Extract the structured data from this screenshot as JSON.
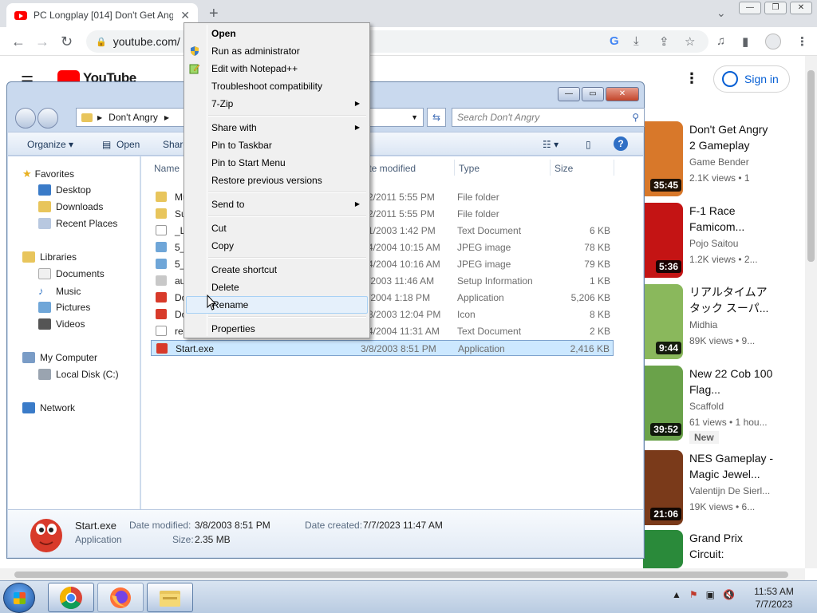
{
  "browser": {
    "tab_title": "PC Longplay [014] Don't Get Angry",
    "tab_close": "✕",
    "new_tab": "+",
    "url": "youtube.com/"
  },
  "youtube": {
    "logo": "YouTube",
    "sign_in": "Sign in",
    "videos": [
      {
        "title": "Don't Get Angry 2 Gameplay",
        "channel": "Game Bender",
        "meta": "2.1K views • 1",
        "duration": "35:45",
        "thumb_color": "#d8782a"
      },
      {
        "title": "F-1 Race Famicom...",
        "channel": "Pojo Saitou",
        "meta": "1.2K views • 2...",
        "duration": "5:36",
        "thumb_color": "#c41414"
      },
      {
        "title": "リアルタイムアタック スーパ...",
        "channel": "Midhia",
        "meta": "89K views • 9...",
        "duration": "9:44",
        "thumb_color": "#8ab85c"
      },
      {
        "title": "New 22 Cob 100 Flag...",
        "channel": "Scaffold",
        "meta": "61 views • 1 hou...",
        "badge": "New",
        "duration": "39:52",
        "thumb_color": "#6aa24a"
      },
      {
        "title": "NES Gameplay - Magic Jewel...",
        "channel": "Valentijn De Sierl...",
        "meta": "19K views • 6...",
        "duration": "21:06",
        "thumb_color": "#7a3a1a"
      },
      {
        "title": "Grand Prix Circuit:",
        "channel": "",
        "meta": "",
        "duration": "",
        "thumb_color": "#2a8a3a"
      }
    ]
  },
  "explorer": {
    "address": "Don't Angry",
    "search_placeholder": "Search Don't Angry",
    "commands": {
      "organize": "Organize ▾",
      "open": "Open",
      "share": "Share"
    },
    "columns": {
      "name": "Name",
      "date": "Date modified",
      "type": "Type",
      "size": "Size"
    },
    "nav": {
      "favorites": "Favorites",
      "desktop": "Desktop",
      "downloads": "Downloads",
      "recent": "Recent Places",
      "libraries": "Libraries",
      "documents": "Documents",
      "music": "Music",
      "pictures": "Pictures",
      "videos": "Videos",
      "computer": "My Computer",
      "local_disk": "Local Disk (C:)",
      "network": "Network"
    },
    "files": [
      {
        "name": "Mu",
        "date": "/22/2011 5:55 PM",
        "type": "File folder",
        "size": "",
        "icon": "#e8c55c"
      },
      {
        "name": "Sup",
        "date": "/22/2011 5:55 PM",
        "type": "File folder",
        "size": "",
        "icon": "#e8c55c"
      },
      {
        "name": "_Le",
        "date": "/21/2003 1:42 PM",
        "type": "Text Document",
        "size": "6 KB",
        "icon": "#ffffff"
      },
      {
        "name": "5_1",
        "date": "/14/2004 10:15 AM",
        "type": "JPEG image",
        "size": "78 KB",
        "icon": "#6fa6d8"
      },
      {
        "name": "5_2",
        "date": "/14/2004 10:16 AM",
        "type": "JPEG image",
        "size": "79 KB",
        "icon": "#6fa6d8"
      },
      {
        "name": "aut",
        "date": "/6/2003 11:46 AM",
        "type": "Setup Information",
        "size": "1 KB",
        "icon": "#c8c8c8"
      },
      {
        "name": "Do",
        "date": "/5/2004 1:18 PM",
        "type": "Application",
        "size": "5,206 KB",
        "icon": "#d83a2a"
      },
      {
        "name": "Do",
        "date": "/28/2003 12:04 PM",
        "type": "Icon",
        "size": "8 KB",
        "icon": "#d83a2a"
      },
      {
        "name": "rea",
        "date": "/14/2004 11:31 AM",
        "type": "Text Document",
        "size": "2 KB",
        "icon": "#ffffff"
      },
      {
        "name": "Start.exe",
        "date": "3/8/2003 8:51 PM",
        "type": "Application",
        "size": "2,416 KB",
        "icon": "#d83a2a",
        "selected": true
      }
    ],
    "details": {
      "name": "Start.exe",
      "kind": "Application",
      "modified_label": "Date modified:",
      "modified": "3/8/2003 8:51 PM",
      "created_label": "Date created:",
      "created": "7/7/2023 11:47 AM",
      "size_label": "Size:",
      "size": "2.35 MB"
    }
  },
  "context_menu": {
    "items": [
      {
        "label": "Open",
        "bold": true
      },
      {
        "label": "Run as administrator",
        "icon": "shield"
      },
      {
        "label": "Edit with Notepad++",
        "icon": "notepad"
      },
      {
        "label": "Troubleshoot compatibility"
      },
      {
        "label": "7-Zip",
        "submenu": true
      },
      {
        "separator": true
      },
      {
        "label": "Share with",
        "submenu": true
      },
      {
        "label": "Pin to Taskbar"
      },
      {
        "label": "Pin to Start Menu"
      },
      {
        "label": "Restore previous versions"
      },
      {
        "separator": true
      },
      {
        "label": "Send to",
        "submenu": true
      },
      {
        "separator": true
      },
      {
        "label": "Cut"
      },
      {
        "label": "Copy"
      },
      {
        "separator": true
      },
      {
        "label": "Create shortcut"
      },
      {
        "label": "Delete"
      },
      {
        "label": "Rename",
        "highlighted": true
      },
      {
        "separator": true
      },
      {
        "label": "Properties"
      }
    ]
  },
  "taskbar": {
    "time": "11:53 AM",
    "date": "7/7/2023"
  }
}
